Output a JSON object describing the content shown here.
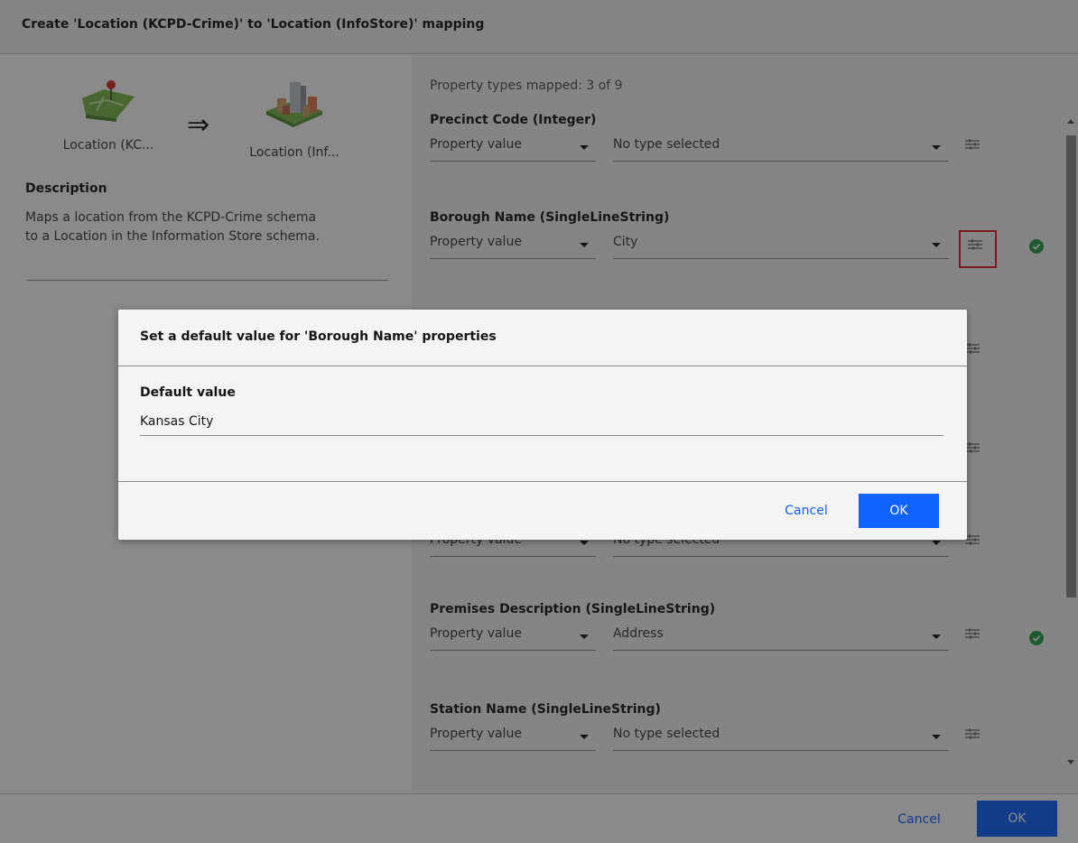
{
  "dialog": {
    "title": "Create 'Location (KCPD-Crime)' to 'Location (InfoStore)' mapping",
    "source_entity": "Location (KC...",
    "target_entity": "Location (Inf...",
    "arrow": "⇒",
    "description_title": "Description",
    "description_lines": [
      "Maps a location from the KCPD-Crime schema",
      "to a Location in the Information Store schema."
    ],
    "mapped_summary": "Property types mapped: 3 of 9",
    "properties": [
      {
        "name": "Precinct Code (Integer)",
        "source": "Property value",
        "target": "No type selected",
        "mapped": false
      },
      {
        "name": "Borough Name (SingleLineString)",
        "source": "Property value",
        "target": "City",
        "mapped": true
      },
      {
        "name": "",
        "source": "Property value",
        "target": "No type selected",
        "mapped": false
      },
      {
        "name": "Premises Description (SingleLineString)",
        "source": "Property value",
        "target": "Address",
        "mapped": true
      },
      {
        "name": "Station Name (SingleLineString)",
        "source": "Property value",
        "target": "No type selected",
        "mapped": false
      }
    ],
    "cancel_label": "Cancel",
    "ok_label": "OK"
  },
  "modal": {
    "title": "Set a default value for 'Borough Name' properties",
    "field_label": "Default value",
    "field_value": "Kansas City",
    "cancel_label": "Cancel",
    "ok_label": "OK"
  },
  "icons": {
    "source_entity": "map-location-icon",
    "target_entity": "buildings-location-icon",
    "property_settings": "settings-adjust-icon",
    "mapped_status": "checkmark-filled-icon"
  },
  "colors": {
    "primary": "#0f62fe",
    "success": "#24a148",
    "highlight": "#da1e28",
    "overlay": "rgba(22,22,22,0.5)"
  }
}
